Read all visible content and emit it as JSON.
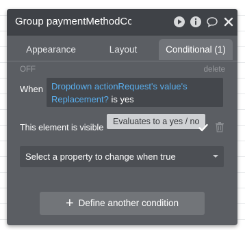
{
  "header": {
    "title": "Group paymentMethodCc",
    "icons": [
      "play-circle-icon",
      "info-icon",
      "comment-icon",
      "close-icon"
    ]
  },
  "tabs": [
    {
      "label": "Appearance",
      "active": false
    },
    {
      "label": "Layout",
      "active": false
    },
    {
      "label": "Conditional (1)",
      "active": true
    }
  ],
  "condition": {
    "status": "OFF",
    "delete_label": "delete",
    "when_label": "When",
    "expression_link": "Dropdown actionRequest's value's Replacement?",
    "expression_rest": " is yes",
    "tooltip": "Evaluates to a yes / no",
    "visible_label": "This element is visible",
    "visible_checked": true,
    "property_select": "Select a property to change when true"
  },
  "actions": {
    "define_label": "Define another condition"
  },
  "colors": {
    "panel": "#5b5e63",
    "header": "#3f4247",
    "link": "#5ab0f0"
  }
}
